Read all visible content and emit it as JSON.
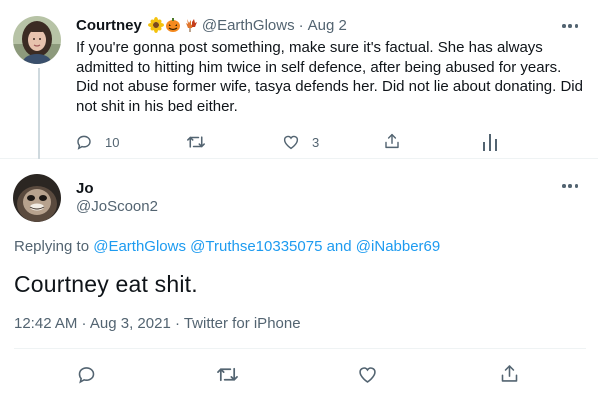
{
  "tweet": {
    "author_name": "Courtney",
    "author_handle": "@EarthGlows",
    "separator": "·",
    "date": "Aug 2",
    "emojis": [
      "sunflower-emoji",
      "jack-o-lantern-emoji",
      "maple-leaves-emoji"
    ],
    "text": "If you're gonna post something, make sure it's factual.  She has always admitted to hitting him twice in self defence, after being abused for years. Did not abuse former wife, tasya defends her. Did not lie about donating. Did not shit in his bed either.",
    "reply_count": "10",
    "retweet_count": "",
    "like_count": "3"
  },
  "reply": {
    "author_name": "Jo",
    "author_handle": "@JoScoon2",
    "replying_prefix": "Replying to ",
    "mention_1": "@EarthGlows",
    "mention_2": "@Truthse10335075",
    "mention_joiner": " and ",
    "mention_3": "@iNabber69",
    "text": "Courtney eat shit.",
    "timestamp": "12:42 AM · Aug 3, 2021 · Twitter for iPhone"
  },
  "icons": {
    "reply": "reply-icon",
    "retweet": "retweet-icon",
    "like": "heart-icon",
    "share": "share-icon",
    "analytics": "analytics-icon",
    "more": "more-icon"
  },
  "colors": {
    "text": "#0f1419",
    "secondary": "#536471",
    "link": "#1d9bf0",
    "border": "#eff3f4"
  }
}
